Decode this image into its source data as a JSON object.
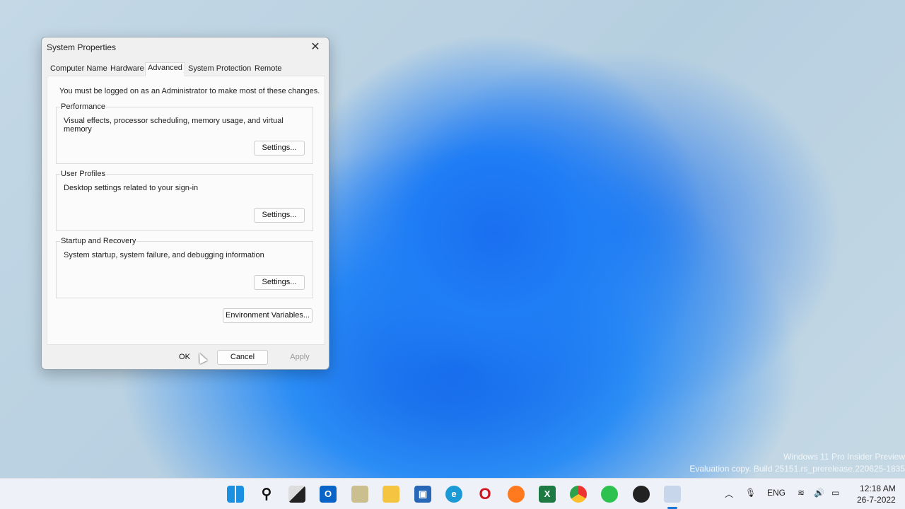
{
  "dialog": {
    "title": "System Properties",
    "tabs": [
      "Computer Name",
      "Hardware",
      "Advanced",
      "System Protection",
      "Remote"
    ],
    "active_tab": "Advanced",
    "note": "You must be logged on as an Administrator to make most of these changes.",
    "groups": [
      {
        "label": "Performance",
        "description": "Visual effects, processor scheduling, memory usage, and virtual memory",
        "button": "Settings..."
      },
      {
        "label": "User Profiles",
        "description": "Desktop settings related to your sign-in",
        "button": "Settings..."
      },
      {
        "label": "Startup and Recovery",
        "description": "System startup, system failure, and debugging information",
        "button": "Settings..."
      }
    ],
    "env_button": "Environment Variables...",
    "ok": "OK",
    "cancel": "Cancel",
    "apply": "Apply"
  },
  "watermark": {
    "line1": "Windows 11 Pro Insider Preview",
    "line2": "Evaluation copy. Build 25151.rs_prerelease.220625-1835"
  },
  "taskbar": {
    "apps": [
      "start",
      "search",
      "task-view",
      "outlook",
      "photos",
      "file-explorer",
      "store",
      "edge",
      "opera",
      "firefox",
      "excel",
      "chrome",
      "wechat",
      "obs",
      "system-properties"
    ],
    "language": "ENG",
    "time": "12:18 AM",
    "date": "26-7-2022"
  }
}
